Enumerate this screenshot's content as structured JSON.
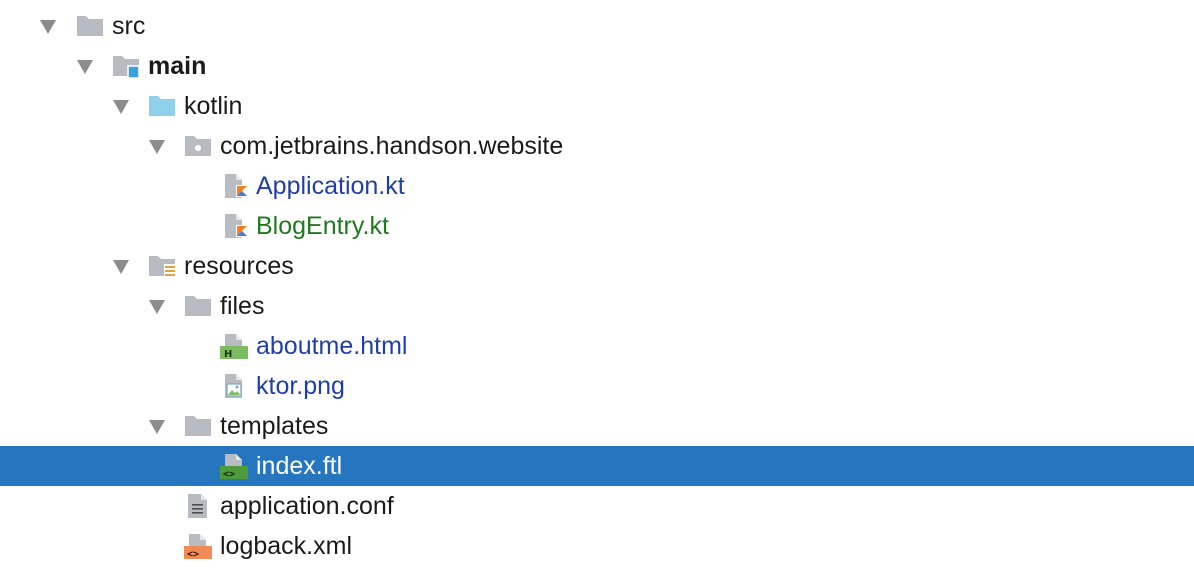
{
  "tree": {
    "items": [
      {
        "label": "src",
        "icon": "folder-icon",
        "expanded": true
      },
      {
        "label": "main",
        "icon": "source-root-folder-icon",
        "expanded": true
      },
      {
        "label": "kotlin",
        "icon": "kotlin-source-folder-icon",
        "expanded": true
      },
      {
        "label": "com.jetbrains.handson.website",
        "icon": "package-icon",
        "expanded": true
      },
      {
        "label": "Application.kt",
        "icon": "kotlin-file-icon",
        "status": "modified"
      },
      {
        "label": "BlogEntry.kt",
        "icon": "kotlin-file-icon",
        "status": "added"
      },
      {
        "label": "resources",
        "icon": "resources-folder-icon",
        "expanded": true
      },
      {
        "label": "files",
        "icon": "folder-icon",
        "expanded": true
      },
      {
        "label": "aboutme.html",
        "icon": "html-file-icon",
        "status": "modified"
      },
      {
        "label": "ktor.png",
        "icon": "image-file-icon",
        "status": "modified"
      },
      {
        "label": "templates",
        "icon": "folder-icon",
        "expanded": true
      },
      {
        "label": "index.ftl",
        "icon": "template-file-icon",
        "selected": true
      },
      {
        "label": "application.conf",
        "icon": "text-file-icon"
      },
      {
        "label": "logback.xml",
        "icon": "xml-file-icon"
      }
    ]
  },
  "colors": {
    "selection": "#2675bf",
    "modified_text": "#1f3fa8",
    "added_text": "#1f7a1f",
    "folder_gray": "#b8bcc2",
    "kotlin_folder": "#8fd0ea"
  }
}
